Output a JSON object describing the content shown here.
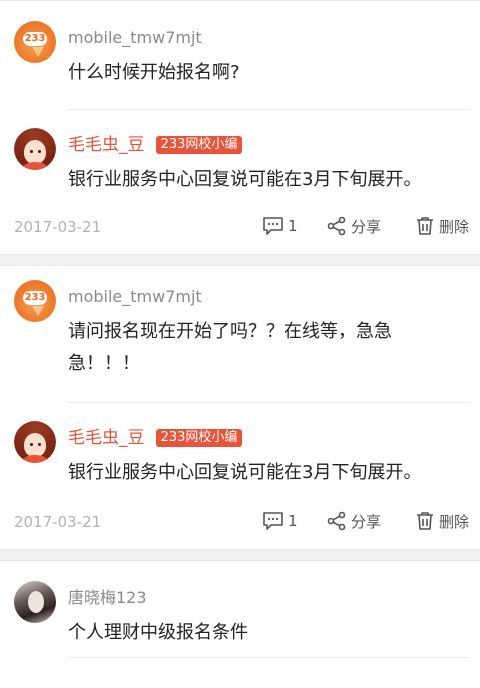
{
  "threads": [
    {
      "author": "mobile_tmw7mjt",
      "avatar_icon": "logo-233-avatar",
      "question": "什么时候开始报名啊?",
      "reply": {
        "name": "毛毛虫_豆",
        "badge": "233网校小编",
        "avatar_icon": "cartoon-girl-avatar",
        "text": "银行业服务中心回复说可能在3月下旬展开。"
      },
      "date": "2017-03-21",
      "comment_count": "1",
      "share_label": "分享",
      "delete_label": "删除"
    },
    {
      "author": "mobile_tmw7mjt",
      "avatar_icon": "logo-233-avatar",
      "question_line1": "请问报名现在开始了吗？？在线等，急急",
      "question_line2": "急！！！",
      "reply": {
        "name": "毛毛虫_豆",
        "badge": "233网校小编",
        "avatar_icon": "cartoon-girl-avatar",
        "text": "银行业服务中心回复说可能在3月下旬展开。"
      },
      "date": "2017-03-21",
      "comment_count": "1",
      "share_label": "分享",
      "delete_label": "删除"
    },
    {
      "author": "唐晓梅123",
      "avatar_icon": "user-photo-avatar",
      "question": "个人理财中级报名条件"
    }
  ],
  "colors": {
    "accent": "#e8543a",
    "muted_text": "#8a8a8a",
    "date_text": "#b3b3b3"
  }
}
